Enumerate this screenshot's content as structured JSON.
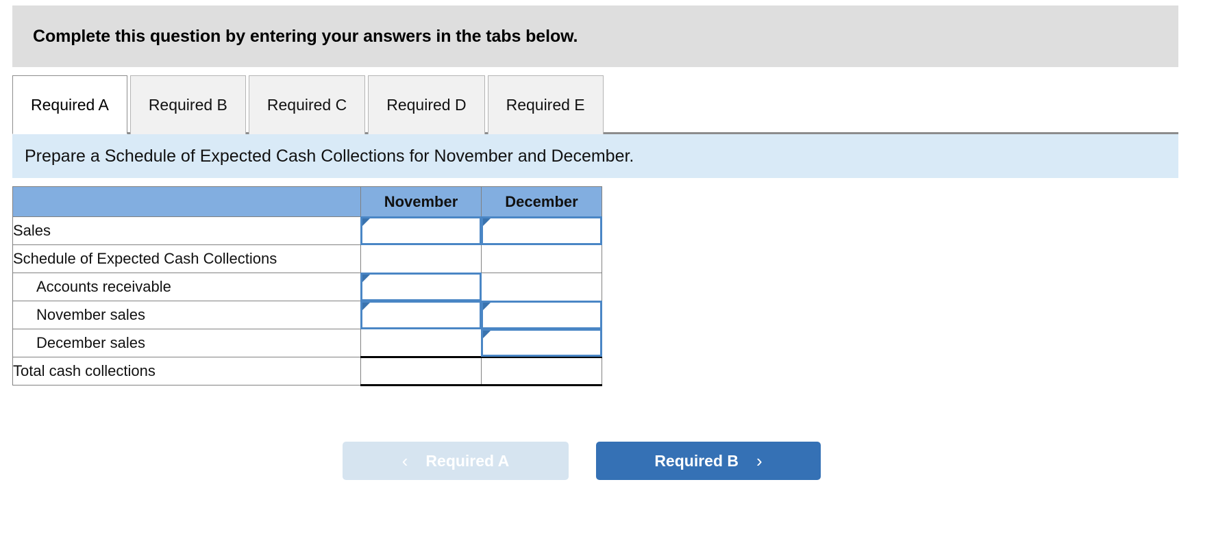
{
  "banner": {
    "text": "Complete this question by entering your answers in the tabs below."
  },
  "tabs": [
    {
      "label": "Required A",
      "active": true
    },
    {
      "label": "Required B",
      "active": false
    },
    {
      "label": "Required C",
      "active": false
    },
    {
      "label": "Required D",
      "active": false
    },
    {
      "label": "Required E",
      "active": false
    }
  ],
  "prompt": {
    "text": "Prepare a Schedule of Expected Cash Collections for November and December."
  },
  "table": {
    "columns": [
      "",
      "November",
      "December"
    ],
    "rows": [
      {
        "label": "Sales",
        "indent": false,
        "total": false,
        "november": {
          "input": true,
          "value": ""
        },
        "december": {
          "input": true,
          "value": ""
        }
      },
      {
        "label": "Schedule of Expected Cash Collections",
        "indent": false,
        "total": false,
        "november": {
          "input": false,
          "value": ""
        },
        "december": {
          "input": false,
          "value": ""
        }
      },
      {
        "label": "Accounts receivable",
        "indent": true,
        "total": false,
        "november": {
          "input": true,
          "value": ""
        },
        "december": {
          "input": false,
          "value": ""
        }
      },
      {
        "label": "November sales",
        "indent": true,
        "total": false,
        "november": {
          "input": true,
          "value": ""
        },
        "december": {
          "input": true,
          "value": ""
        }
      },
      {
        "label": "December sales",
        "indent": true,
        "total": false,
        "november": {
          "input": false,
          "value": ""
        },
        "december": {
          "input": true,
          "value": ""
        }
      },
      {
        "label": "Total cash collections",
        "indent": false,
        "total": true,
        "november": {
          "input": false,
          "value": ""
        },
        "december": {
          "input": false,
          "value": ""
        }
      }
    ]
  },
  "nav": {
    "prev_label": "Required A",
    "next_label": "Required B",
    "prev_icon": "chevron-left-icon",
    "next_icon": "chevron-right-icon",
    "prev_chevron": "‹",
    "next_chevron": "›",
    "prev_disabled": true
  },
  "colors": {
    "banner_bg": "#dedede",
    "prompt_bg": "#d9eaf7",
    "table_header_bg": "#82aee0",
    "input_border": "#4a86c5",
    "flag": "#3a73ae",
    "next_button_bg": "#3571b5",
    "prev_button_bg": "#d6e4f0"
  }
}
